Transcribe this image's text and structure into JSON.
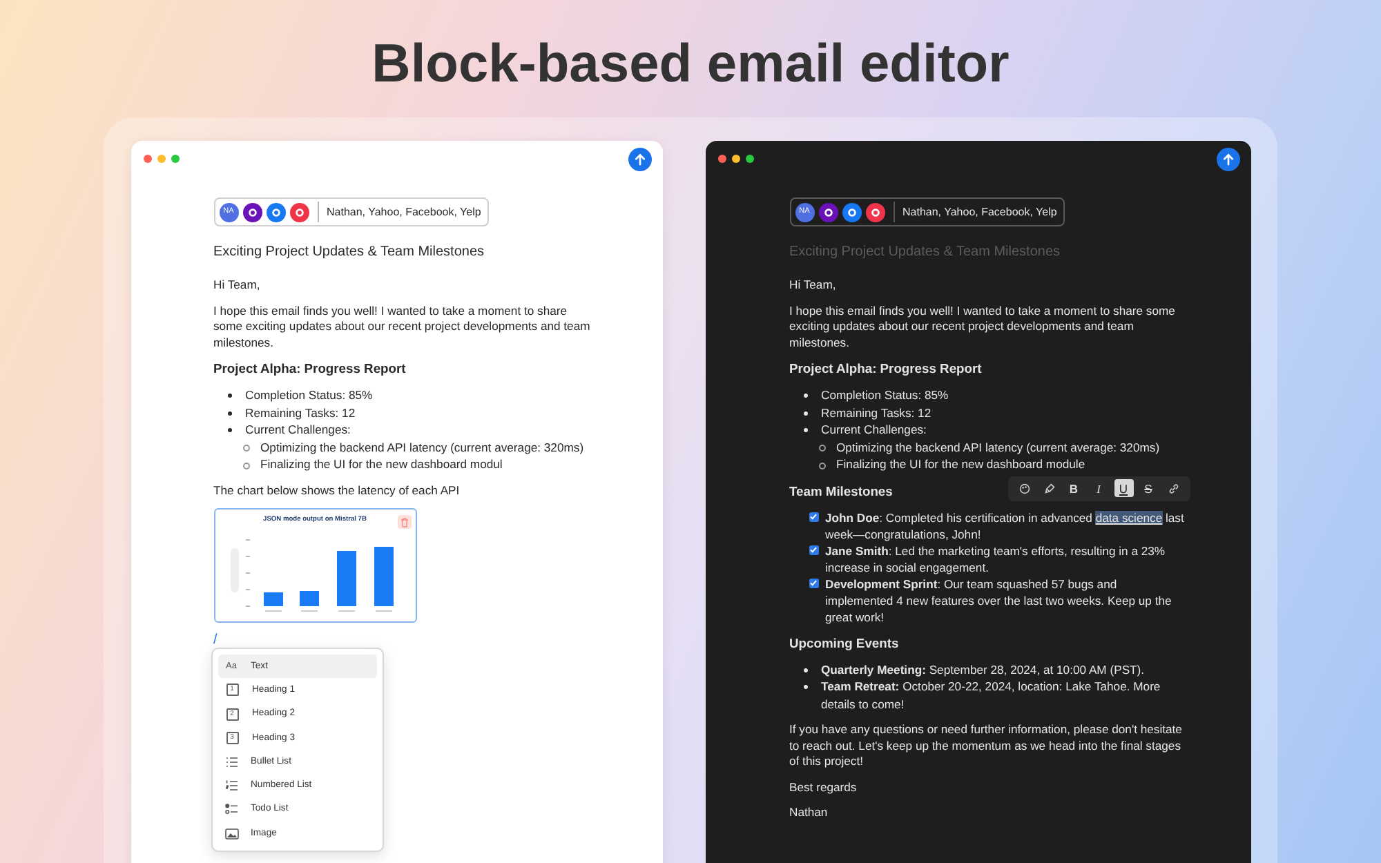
{
  "headline": "Block-based email editor",
  "windows": [
    {
      "kind": "light",
      "recipients": {
        "avatars": [
          {
            "kind": "initials",
            "label": "NA",
            "color": "#4f6fe3"
          },
          {
            "kind": "logo",
            "color": "#6a12b8"
          },
          {
            "kind": "logo",
            "color": "#1877f2"
          },
          {
            "kind": "logo",
            "color": "#ef3349"
          }
        ],
        "names": "Nathan, Yahoo, Facebook, Yelp"
      },
      "subject": {
        "text": "Exciting Project Updates & Team Milestones",
        "dimmed": false
      },
      "blocks": [
        {
          "kind": "paragraph",
          "text": "Hi Team,"
        },
        {
          "kind": "paragraph",
          "text": "I hope this email finds you well! I wanted to take a moment to share some exciting updates about our recent project developments and team milestones."
        },
        {
          "kind": "heading",
          "text": "Project Alpha: Progress Report"
        },
        {
          "kind": "bullets",
          "items": [
            {
              "text": "Completion Status: 85%"
            },
            {
              "text": "Remaining Tasks: 12"
            },
            {
              "text": "Current Challenges:",
              "children": [
                {
                  "text": "Optimizing the backend API latency (current average: 320ms)"
                },
                {
                  "text": "Finalizing the UI for the new dashboard modul"
                }
              ]
            }
          ]
        },
        {
          "kind": "paragraph",
          "text": "The chart below shows the latency of each API"
        },
        {
          "kind": "chart",
          "title": "JSON mode output on Mistral 7B"
        },
        {
          "kind": "slash",
          "text": "/",
          "menu": [
            {
              "kind": "glyph",
              "badge": "Aa",
              "label": "Text",
              "selected": true
            },
            {
              "kind": "boxed",
              "badge": "1",
              "label": "Heading 1",
              "selected": false
            },
            {
              "kind": "boxed",
              "badge": "2",
              "label": "Heading 2",
              "selected": false
            },
            {
              "kind": "boxed",
              "badge": "3",
              "label": "Heading 3",
              "selected": false
            },
            {
              "kind": "bullets",
              "label": "Bullet List",
              "selected": false
            },
            {
              "kind": "numbers",
              "label": "Numbered List",
              "selected": false
            },
            {
              "kind": "todo",
              "label": "Todo List",
              "selected": false
            },
            {
              "kind": "image",
              "label": "Image",
              "selected": false
            }
          ]
        }
      ]
    },
    {
      "kind": "dark",
      "recipients": {
        "avatars": [
          {
            "kind": "initials",
            "label": "NA",
            "color": "#4f6fe3"
          },
          {
            "kind": "logo",
            "color": "#6a12b8"
          },
          {
            "kind": "logo",
            "color": "#1877f2"
          },
          {
            "kind": "logo",
            "color": "#ef3349"
          }
        ],
        "names": "Nathan, Yahoo, Facebook, Yelp"
      },
      "subject": {
        "text": "Exciting Project Updates & Team Milestones",
        "dimmed": true
      },
      "blocks": [
        {
          "kind": "paragraph",
          "text": "Hi Team,"
        },
        {
          "kind": "paragraph",
          "text": "I hope this email finds you well! I wanted to take a moment to share some exciting updates about our recent project developments and team milestones."
        },
        {
          "kind": "heading",
          "text": "Project Alpha: Progress Report"
        },
        {
          "kind": "bullets",
          "items": [
            {
              "text": "Completion Status: 85%"
            },
            {
              "text": "Remaining Tasks: 12"
            },
            {
              "text": "Current Challenges:",
              "children": [
                {
                  "text": "Optimizing the backend API latency (current average: 320ms)"
                },
                {
                  "text": "Finalizing the UI for the new dashboard module"
                }
              ]
            }
          ]
        },
        {
          "kind": "heading",
          "text": "Team Milestones",
          "toolbar": [
            {
              "kind": "color",
              "selected": false
            },
            {
              "kind": "highlight",
              "selected": false
            },
            {
              "kind": "bold",
              "label": "B",
              "selected": false
            },
            {
              "kind": "italic",
              "label": "I",
              "selected": false
            },
            {
              "kind": "underline",
              "label": "U",
              "selected": true
            },
            {
              "kind": "strike",
              "label": "S",
              "selected": false
            },
            {
              "kind": "link",
              "selected": false
            }
          ]
        },
        {
          "kind": "todos",
          "items": [
            {
              "checked": true,
              "segments": [
                {
                  "kind": "bold",
                  "text": "John Doe"
                },
                {
                  "kind": "plain",
                  "text": ": Completed his certification in advanced "
                },
                {
                  "kind": "selection",
                  "text": "data science"
                },
                {
                  "kind": "plain",
                  "text": " last week—congratulations, John!"
                }
              ]
            },
            {
              "checked": true,
              "segments": [
                {
                  "kind": "bold",
                  "text": "Jane Smith"
                },
                {
                  "kind": "plain",
                  "text": ": Led the marketing team's efforts, resulting in a 23% increase in social engagement."
                }
              ]
            },
            {
              "checked": true,
              "segments": [
                {
                  "kind": "bold",
                  "text": "Development Sprint"
                },
                {
                  "kind": "plain",
                  "text": ": Our team squashed 57 bugs and implemented 4 new features over the last two weeks. Keep up the great work!"
                }
              ]
            }
          ]
        },
        {
          "kind": "heading",
          "text": "Upcoming Events"
        },
        {
          "kind": "bullets",
          "items": [
            {
              "text": "**Quarterly Meeting:** September 28, 2024, at 10:00 AM (PST)."
            },
            {
              "text": "**Team Retreat:** October 20-22, 2024, location: Lake Tahoe. More details to come!"
            }
          ]
        },
        {
          "kind": "paragraph",
          "text": "If you have any questions or need further information, please don't hesitate to reach out. Let's keep up the momentum as we head into the final stages of this project!"
        },
        {
          "kind": "paragraph",
          "text": "Best regards"
        },
        {
          "kind": "paragraph",
          "text": "Nathan"
        }
      ]
    }
  ]
}
